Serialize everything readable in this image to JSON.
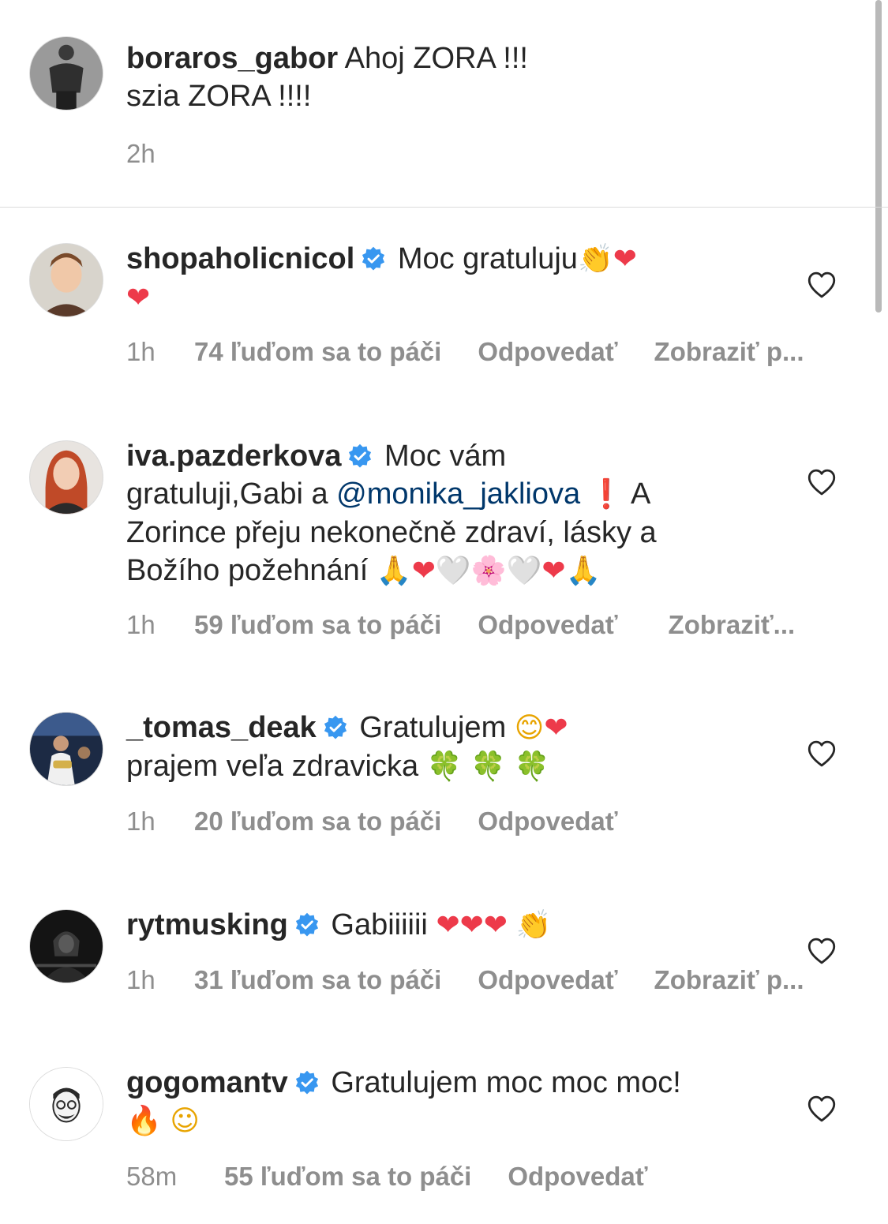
{
  "caption": {
    "username": "boraros_gabor",
    "line1": "Ahoj ZORA !!!",
    "line2": "szia ZORA !!!!",
    "time": "2h"
  },
  "comments": [
    {
      "username": "shopaholicnicol",
      "text": "Moc gratuluju",
      "emoji": [
        "👏",
        "❤",
        "❤"
      ],
      "time": "1h",
      "likes": "74 ľuďom sa to páči",
      "reply": "Odpovedať",
      "more": "Zobraziť p..."
    },
    {
      "username": "iva.pazderkova",
      "text_a": "Moc vám",
      "text_b": "gratuluji,Gabi a",
      "mention": "@monika_jakliova",
      "text_c": "A",
      "text_d": "Zorince přeju nekonečně zdraví, lásky a",
      "text_e": "Božího požehnání",
      "emoji": [
        "❗",
        "🙏",
        "❤",
        "🤍",
        "🌸",
        "🤍",
        "❤",
        "🙏"
      ],
      "time": "1h",
      "likes": "59 ľuďom sa to páči",
      "reply": "Odpovedať",
      "more": "Zobraziť..."
    },
    {
      "username": "_tomas_deak",
      "text_a": "Gratulujem",
      "text_b": "prajem veľa zdravicka",
      "emoji": [
        "😊",
        "❤",
        "🍀",
        "🍀",
        "🍀"
      ],
      "time": "1h",
      "likes": "20 ľuďom sa to páči",
      "reply": "Odpovedať"
    },
    {
      "username": "rytmusking",
      "text": "Gabiiiiii",
      "emoji": [
        "❤",
        "❤",
        "❤",
        "👏"
      ],
      "time": "1h",
      "likes": "31 ľuďom sa to páči",
      "reply": "Odpovedať",
      "more": "Zobraziť p..."
    },
    {
      "username": "gogomantv",
      "text": "Gratulujem moc moc moc!",
      "emoji": [
        "🔥",
        "☺"
      ],
      "time": "58m",
      "likes": "55 ľuďom sa to páči",
      "reply": "Odpovedať"
    }
  ],
  "colors": {
    "text": "#262626",
    "meta": "#8e8e8e",
    "verified": "#3897f0",
    "mention": "#00376b",
    "heart_red": "#ed3a4a"
  },
  "icons": {
    "verified": "verified-badge-icon",
    "like": "heart-outline-icon"
  }
}
